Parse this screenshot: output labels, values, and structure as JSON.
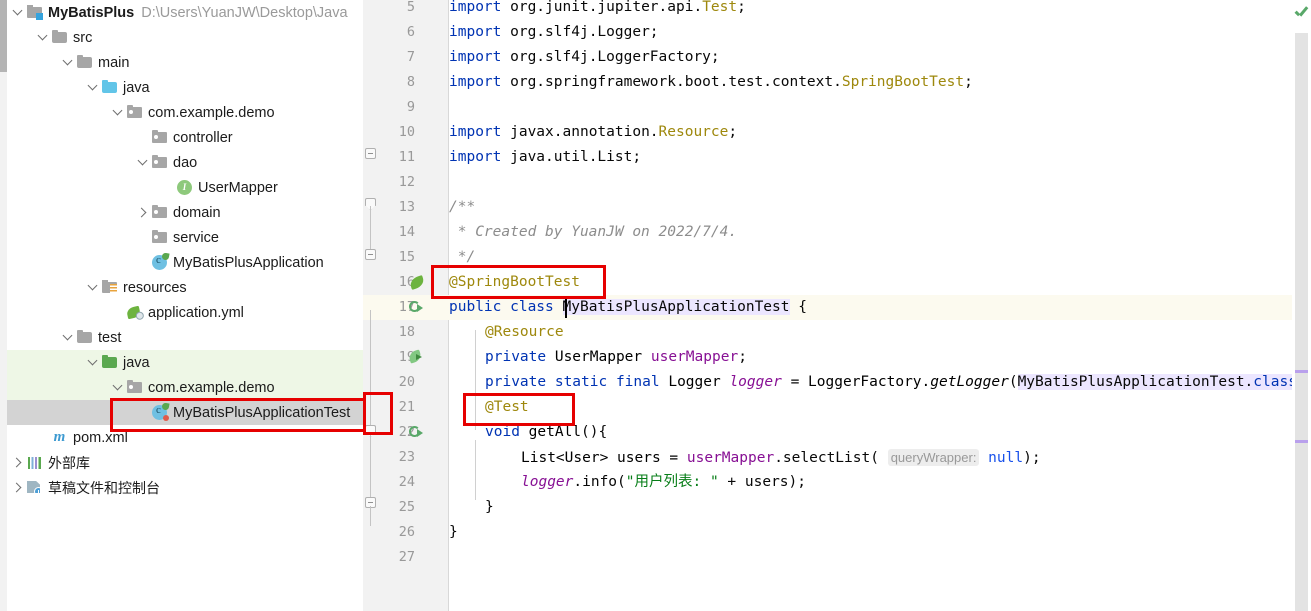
{
  "window": {
    "app": "IntelliJ IDEA",
    "ok_indicator": "inspection-ok-check"
  },
  "project_tree": {
    "rows": [
      {
        "label": "MyBatisPlus",
        "path": "D:\\Users\\YuanJW\\Desktop\\Java",
        "icon": "module-folder-icon",
        "twist": "open",
        "depth": 0,
        "bold": true,
        "state": "normal"
      },
      {
        "label": "src",
        "path": "",
        "icon": "folder-icon",
        "twist": "open",
        "depth": 1,
        "bold": false,
        "state": "normal"
      },
      {
        "label": "main",
        "path": "",
        "icon": "folder-icon",
        "twist": "open",
        "depth": 2,
        "bold": false,
        "state": "normal"
      },
      {
        "label": "java",
        "path": "",
        "icon": "source-folder-blue-icon",
        "twist": "open",
        "depth": 3,
        "bold": false,
        "state": "normal"
      },
      {
        "label": "com.example.demo",
        "path": "",
        "icon": "package-icon",
        "twist": "open",
        "depth": 4,
        "bold": false,
        "state": "normal"
      },
      {
        "label": "controller",
        "path": "",
        "icon": "package-icon",
        "twist": "none",
        "depth": 5,
        "bold": false,
        "state": "normal"
      },
      {
        "label": "dao",
        "path": "",
        "icon": "package-icon",
        "twist": "open",
        "depth": 5,
        "bold": false,
        "state": "normal"
      },
      {
        "label": "UserMapper",
        "path": "",
        "icon": "interface-icon",
        "twist": "none",
        "depth": 6,
        "bold": false,
        "state": "normal"
      },
      {
        "label": "domain",
        "path": "",
        "icon": "package-icon",
        "twist": "closed",
        "depth": 5,
        "bold": false,
        "state": "normal"
      },
      {
        "label": "service",
        "path": "",
        "icon": "package-icon",
        "twist": "none",
        "depth": 5,
        "bold": false,
        "state": "normal"
      },
      {
        "label": "MyBatisPlusApplication",
        "path": "",
        "icon": "spring-boot-class-icon",
        "twist": "none",
        "depth": 5,
        "bold": false,
        "state": "normal"
      },
      {
        "label": "resources",
        "path": "",
        "icon": "resources-folder-icon",
        "twist": "open",
        "depth": 3,
        "bold": false,
        "state": "normal"
      },
      {
        "label": "application.yml",
        "path": "",
        "icon": "spring-yaml-icon",
        "twist": "none",
        "depth": 4,
        "bold": false,
        "state": "normal"
      },
      {
        "label": "test",
        "path": "",
        "icon": "folder-icon",
        "twist": "open",
        "depth": 2,
        "bold": false,
        "state": "normal"
      },
      {
        "label": "java",
        "path": "",
        "icon": "test-source-folder-green-icon",
        "twist": "open",
        "depth": 3,
        "bold": false,
        "state": "highlight-green"
      },
      {
        "label": "com.example.demo",
        "path": "",
        "icon": "package-icon",
        "twist": "open",
        "depth": 4,
        "bold": false,
        "state": "highlight-green"
      },
      {
        "label": "MyBatisPlusApplicationTest",
        "path": "",
        "icon": "spring-test-class-icon",
        "twist": "none",
        "depth": 5,
        "bold": false,
        "state": "selected"
      },
      {
        "label": "pom.xml",
        "path": "",
        "icon": "maven-icon",
        "twist": "none",
        "depth": 1,
        "bold": false,
        "state": "normal"
      },
      {
        "label": "外部库",
        "path": "",
        "icon": "external-libraries-icon",
        "twist": "closed",
        "depth": 0,
        "bold": false,
        "state": "normal"
      },
      {
        "label": "草稿文件和控制台",
        "path": "",
        "icon": "scratches-consoles-icon",
        "twist": "closed",
        "depth": 0,
        "bold": false,
        "state": "normal"
      }
    ],
    "annotation_box_color": "#e60000"
  },
  "editor": {
    "first_visible_line": 5,
    "last_visible_line": 27,
    "lines": [
      {
        "n": 5,
        "indent": 0
      },
      {
        "n": 6,
        "indent": 0
      },
      {
        "n": 7,
        "indent": 0
      },
      {
        "n": 8,
        "indent": 0
      },
      {
        "n": 9,
        "indent": 0
      },
      {
        "n": 10,
        "indent": 0
      },
      {
        "n": 11,
        "indent": 0
      },
      {
        "n": 12,
        "indent": 0
      },
      {
        "n": 13,
        "indent": 0
      },
      {
        "n": 14,
        "indent": 0
      },
      {
        "n": 15,
        "indent": 0
      },
      {
        "n": 16,
        "indent": 0
      },
      {
        "n": 17,
        "indent": 0
      },
      {
        "n": 18,
        "indent": 0
      },
      {
        "n": 19,
        "indent": 0
      },
      {
        "n": 20,
        "indent": 0
      },
      {
        "n": 21,
        "indent": 0
      },
      {
        "n": 22,
        "indent": 0
      },
      {
        "n": 23,
        "indent": 0
      },
      {
        "n": 24,
        "indent": 0
      },
      {
        "n": 25,
        "indent": 0
      },
      {
        "n": 26,
        "indent": 0
      },
      {
        "n": 27,
        "indent": 0
      }
    ],
    "code": {
      "l5_import": "import",
      "l5_pkg": " org.junit.jupiter.api.",
      "l5_type": "Test",
      "l5_semi": ";",
      "l6_import": "import",
      "l6_rest": " org.slf4j.Logger;",
      "l7_import": "import",
      "l7_rest": " org.slf4j.LoggerFactory;",
      "l8_import": "import",
      "l8_pkg": " org.springframework.boot.test.context.",
      "l8_type": "SpringBootTest",
      "l8_semi": ";",
      "l10_import": "import",
      "l10_pkg": " javax.annotation.",
      "l10_type": "Resource",
      "l10_semi": ";",
      "l11_import": "import",
      "l11_rest": " java.util.List;",
      "l13_comment": "/**",
      "l14_comment": " * Created by YuanJW on 2022/7/4.",
      "l15_comment": " */",
      "l16_annotation": "@SpringBootTest",
      "l17_kw1": "public",
      "l17_kw2": " class",
      "l17_space": " ",
      "l17_name": "MyBatisPlusApplicationTest",
      "l17_brace": " {",
      "l18_annotation": "@Resource",
      "l19_kw": "private",
      "l19_type": " UserMapper ",
      "l19_field": "userMapper",
      "l19_semi": ";",
      "l20_kw": "private static final",
      "l20_type": " Logger ",
      "l20_field": "logger",
      "l20_eq": " = ",
      "l20_cls": "LoggerFactory.",
      "l20_method": "getLogger",
      "l20_paren": "(",
      "l20_arg": "MyBatisPlusApplicationTest.",
      "l20_classkw": "class",
      "l21_annotation": "@Test",
      "l22_kw": "void",
      "l22_method": " getAll",
      "l22_rest": "(){",
      "l23_type": "List<User> users = ",
      "l23_field": "userMapper",
      "l23_call": ".selectList(",
      "l23_hint": "queryWrapper:",
      "l23_null": "null",
      "l23_end": ");",
      "l24_logger": "logger",
      "l24_info": ".info(",
      "l24_str": "\"用户列表: \"",
      "l24_plus": " + users);",
      "l25_brace": "}",
      "l26_brace": "}"
    },
    "gutter_icons": [
      {
        "line": 16,
        "icon": "spring-leaf-icon"
      },
      {
        "line": 17,
        "icon": "run-test-class-icon"
      },
      {
        "line": 19,
        "icon": "spring-bean-injection-icon"
      },
      {
        "line": 22,
        "icon": "run-test-method-icon"
      }
    ],
    "annotation_boxes": [
      {
        "target": "@SpringBootTest",
        "color": "#e60000"
      },
      {
        "target": "@Test",
        "color": "#e60000"
      },
      {
        "target": "line-number-21",
        "color": "#e60000"
      }
    ],
    "colors": {
      "keyword": "#0033b3",
      "annotation": "#9e880d",
      "string": "#067d17",
      "field": "#871094",
      "comment": "#8c8c8c",
      "number": "#1750eb",
      "identifier_highlight": "#ece6ff",
      "caret_line": "#fcfaef"
    }
  }
}
